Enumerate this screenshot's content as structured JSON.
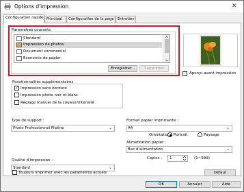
{
  "window": {
    "title": "Options d'impression",
    "close_glyph": "✕"
  },
  "tabs": [
    {
      "label": "Configuration rapide"
    },
    {
      "label": "Principal"
    },
    {
      "label": "Configuration de la page"
    },
    {
      "label": "Entretien"
    }
  ],
  "common_settings": {
    "label": "Paramètres courants",
    "items": [
      {
        "label": "Standard",
        "selected": false,
        "icon": "standard-icon"
      },
      {
        "label": "Impression de photos",
        "selected": true,
        "icon": "photo-icon"
      },
      {
        "label": "Document commercial",
        "selected": false,
        "icon": "document-icon"
      },
      {
        "label": "Économie de papier",
        "selected": false,
        "icon": "paper-saving-icon"
      }
    ],
    "save_button": "Enregistrer...",
    "delete_button": "Supprimer"
  },
  "preview": {
    "label": "Aperçu avant impression"
  },
  "extra_features": {
    "label": "Fonctionnalités supplémentaires",
    "options": [
      {
        "label": "Impression sans bordure",
        "checked": true
      },
      {
        "label": "Impression photo noir et blanc",
        "checked": false
      },
      {
        "label": "Réglage manuel de la couleur/intensité",
        "checked": false
      }
    ]
  },
  "media_type": {
    "label": "Type de support :",
    "value": "Photo Professionnel Platine"
  },
  "paper_size": {
    "label": "Format papier imprimante :",
    "value": "A4"
  },
  "orientation": {
    "label": "Orientation :",
    "portrait": "Portrait",
    "landscape": "Paysage",
    "selected": "Portrait"
  },
  "print_quality": {
    "label": "Qualité d'impression :",
    "value": "Standard"
  },
  "paper_source": {
    "label": "Alimentation papier :",
    "value": "Bac d'alimentation"
  },
  "copies": {
    "label": "Copies :",
    "value": "1",
    "range": "(1~999)"
  },
  "always_print": {
    "label": "Toujours imprimer avec les paramètres actuels",
    "checked": false
  },
  "buttons": {
    "default": "Défaut",
    "ok": "OK",
    "cancel": "Annuler",
    "help": "Aide"
  },
  "colors": {
    "highlight_frame": "#c8182a",
    "selection": "#d6d6d6"
  }
}
